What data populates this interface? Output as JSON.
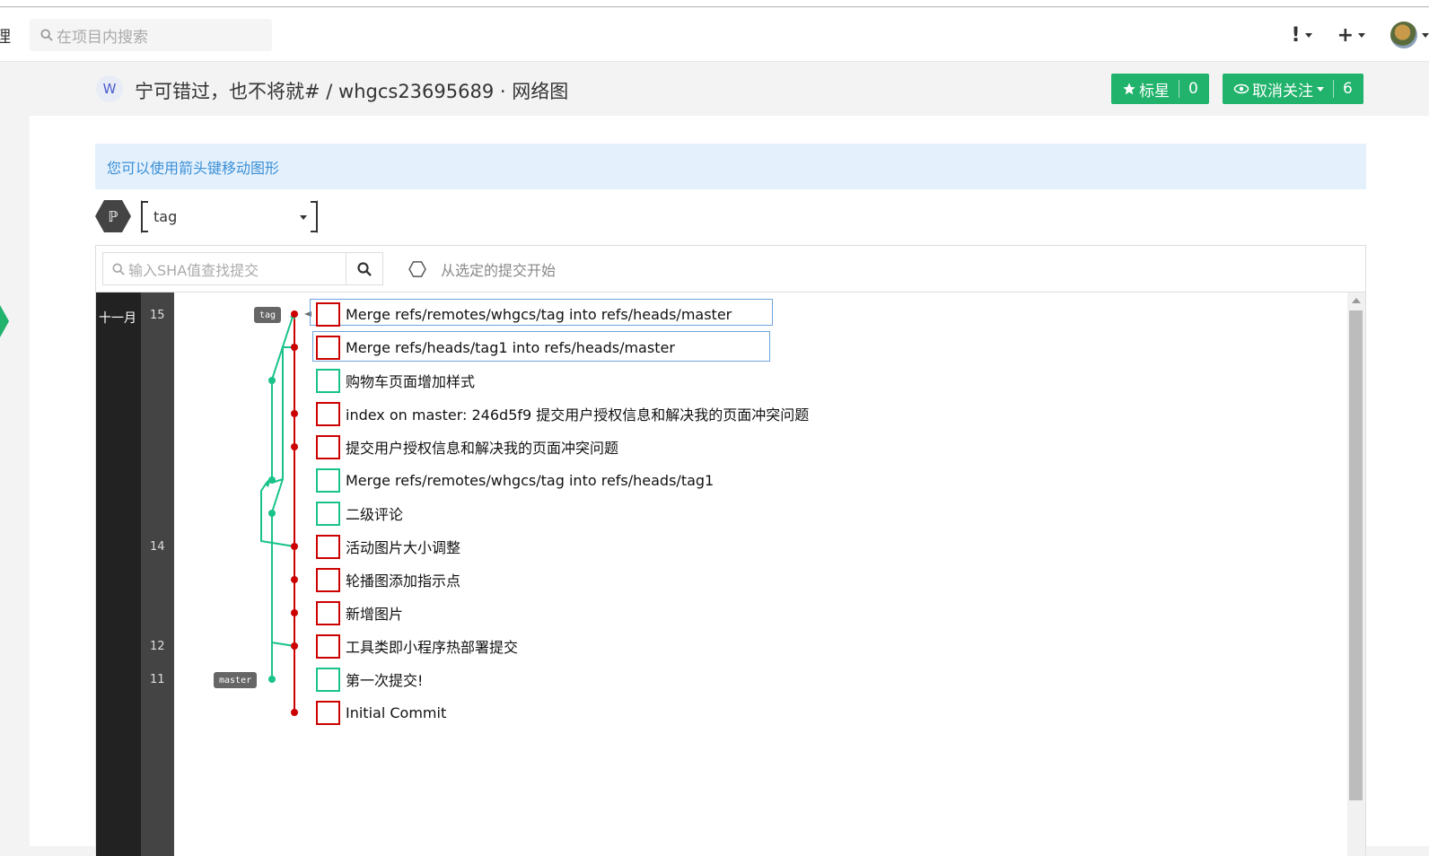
{
  "topbar": {
    "cut_text": "理",
    "search_placeholder": "在项目内搜索",
    "alert_icon": "exclamation-icon",
    "add_icon": "plus-icon"
  },
  "header": {
    "avatar_letter": "W",
    "title": "宁可错过，也不将就# / whgcs23695689 · 网络图",
    "star_label": "标星",
    "star_count": "0",
    "watch_label": "取消关注",
    "watch_count": "6",
    "accent": "#21b26b"
  },
  "tip": "您可以使用箭头键移动图形",
  "branch": {
    "selected": "tag"
  },
  "toolbar": {
    "sha_placeholder": "输入SHA值查找提交",
    "start_from": "从选定的提交开始"
  },
  "graph": {
    "month": "十一月",
    "days": [
      "15",
      "14",
      "12",
      "11"
    ],
    "ref_tag": "tag",
    "ref_master": "master",
    "commits": [
      {
        "message": "Merge refs/remotes/whgcs/tag into refs/heads/master",
        "color": "red"
      },
      {
        "message": "Merge refs/heads/tag1 into refs/heads/master",
        "color": "red"
      },
      {
        "message": "购物车页面增加样式",
        "color": "green"
      },
      {
        "message": "index on master: 246d5f9 提交用户授权信息和解决我的页面冲突问题",
        "color": "red"
      },
      {
        "message": "提交用户授权信息和解决我的页面冲突问题",
        "color": "red"
      },
      {
        "message": "Merge refs/remotes/whgcs/tag into refs/heads/tag1",
        "color": "green"
      },
      {
        "message": "二级评论",
        "color": "green"
      },
      {
        "message": "活动图片大小调整",
        "color": "red"
      },
      {
        "message": "轮播图添加指示点",
        "color": "red"
      },
      {
        "message": "新增图片",
        "color": "red"
      },
      {
        "message": "工具类即小程序热部署提交",
        "color": "red"
      },
      {
        "message": "第一次提交!",
        "color": "green"
      },
      {
        "message": "Initial Commit",
        "color": "red"
      }
    ],
    "line_colors": {
      "master": "#cc0000",
      "tag": "#19c289"
    }
  }
}
